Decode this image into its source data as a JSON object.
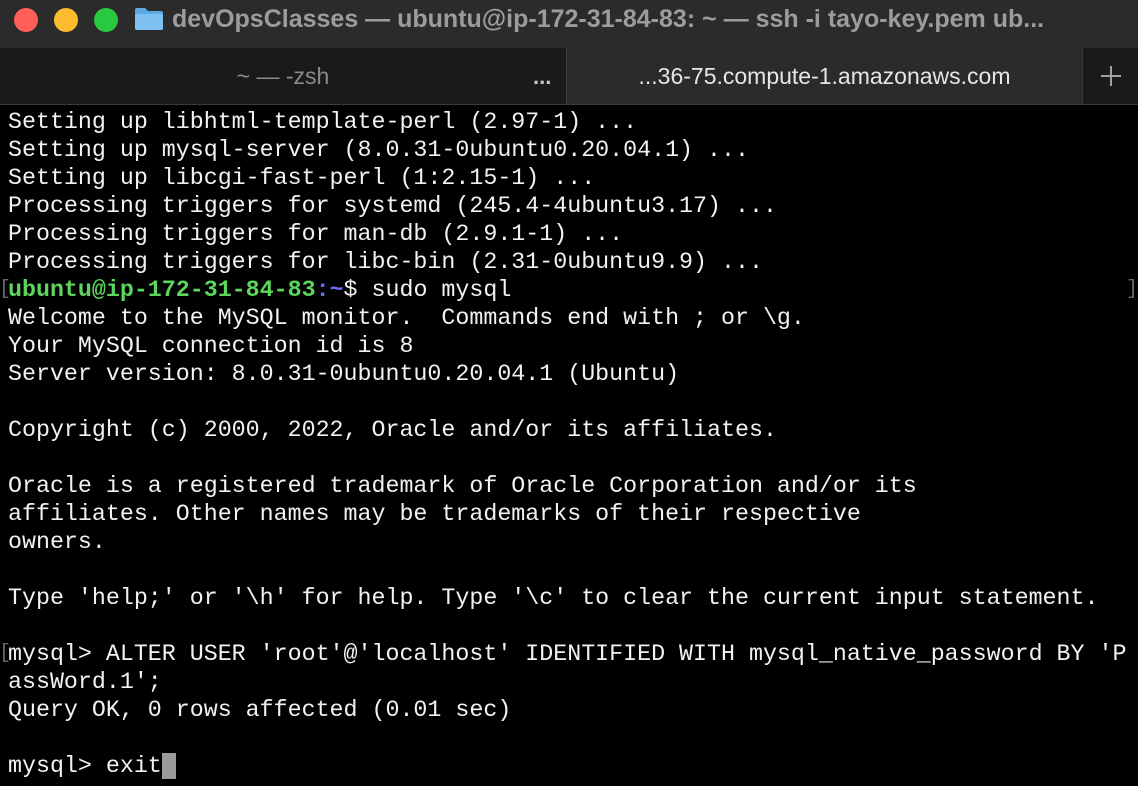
{
  "window": {
    "title": "devOpsClasses — ubuntu@ip-172-31-84-83: ~ — ssh -i tayo-key.pem ub...",
    "folder_icon": "folder-icon"
  },
  "tabs": [
    {
      "label": "~ — -zsh",
      "active": false
    },
    {
      "label": "...36-75.compute-1.amazonaws.com",
      "active": true
    }
  ],
  "tab_overflow": "...",
  "colors": {
    "prompt_user": "#5cd65c",
    "prompt_path": "#6b6bff",
    "close": "#ff5f57",
    "minimize": "#febc2e",
    "maximize": "#28c840"
  },
  "terminal": {
    "lines": [
      "Setting up libhtml-template-perl (2.97-1) ...",
      "Setting up mysql-server (8.0.31-0ubuntu0.20.04.1) ...",
      "Setting up libcgi-fast-perl (1:2.15-1) ...",
      "Processing triggers for systemd (245.4-4ubuntu3.17) ...",
      "Processing triggers for man-db (2.9.1-1) ...",
      "Processing triggers for libc-bin (2.31-0ubuntu9.9) ..."
    ],
    "prompt": {
      "user_host": "ubuntu@ip-172-31-84-83",
      "path": ":~",
      "symbol": "$ ",
      "command": "sudo mysql"
    },
    "welcome": [
      "Welcome to the MySQL monitor.  Commands end with ; or \\g.",
      "Your MySQL connection id is 8",
      "Server version: 8.0.31-0ubuntu0.20.04.1 (Ubuntu)",
      "",
      "Copyright (c) 2000, 2022, Oracle and/or its affiliates.",
      "",
      "Oracle is a registered trademark of Oracle Corporation and/or its",
      "affiliates. Other names may be trademarks of their respective",
      "owners.",
      "",
      "Type 'help;' or '\\h' for help. Type '\\c' to clear the current input statement.",
      ""
    ],
    "mysql_command_1": "mysql> ALTER USER 'root'@'localhost' IDENTIFIED WITH mysql_native_password BY 'P",
    "mysql_command_2": "assWord.1';",
    "query_result": "Query OK, 0 rows affected (0.01 sec)",
    "final_prompt": "mysql> exit"
  }
}
